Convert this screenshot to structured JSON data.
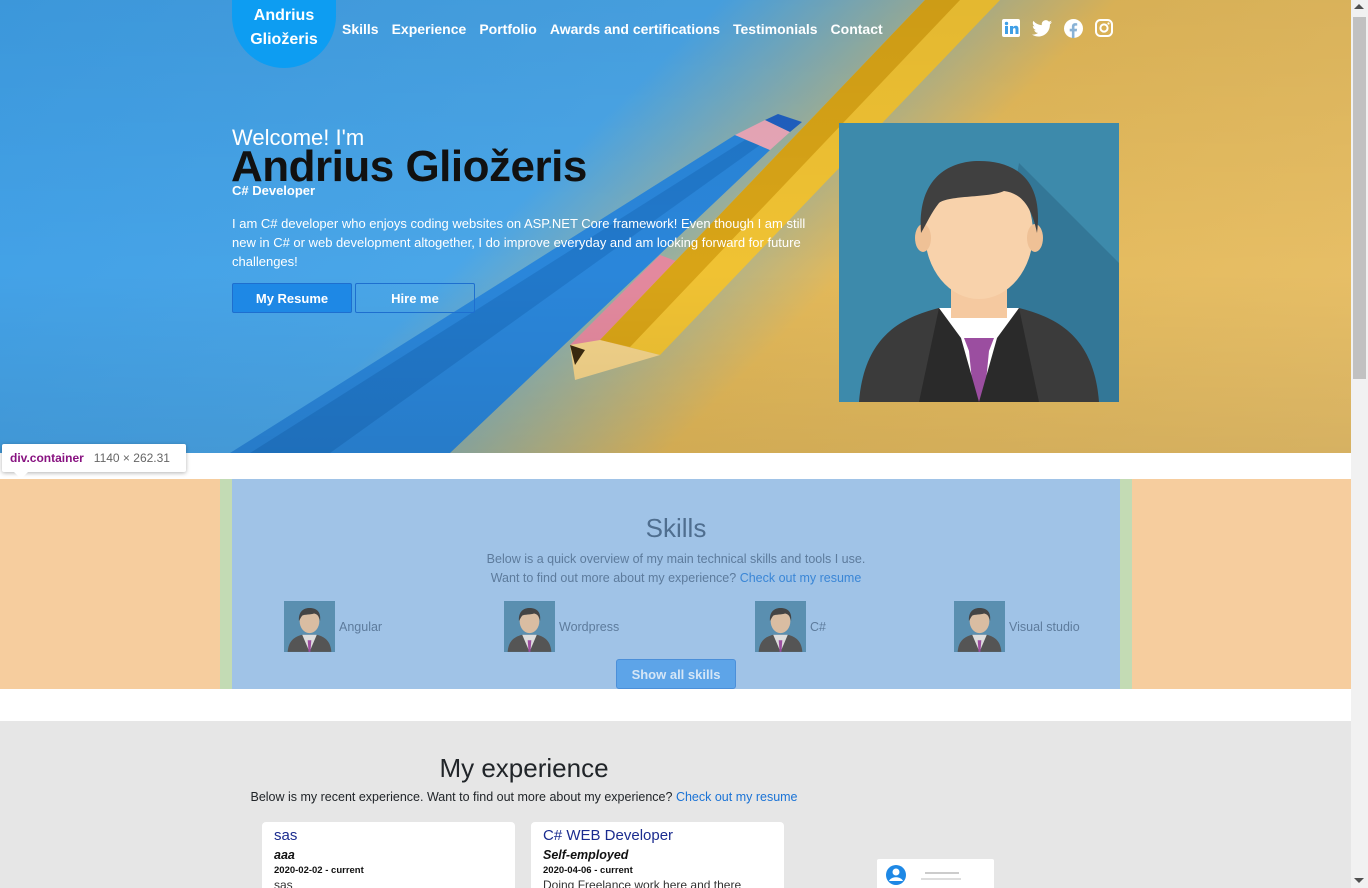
{
  "brand": {
    "line1": "Andrius",
    "line2": "Gliožeris"
  },
  "nav": [
    "Skills",
    "Experience",
    "Portfolio",
    "Awards and certifications",
    "Testimonials",
    "Contact"
  ],
  "social": [
    "linkedin-icon",
    "twitter-icon",
    "facebook-icon",
    "instagram-icon"
  ],
  "hero": {
    "welcome": "Welcome! I'm",
    "name": "Andrius Gliožeris",
    "role": "C# Developer",
    "intro": "I am C# developer who enjoys coding websites on ASP.NET Core framework! Even though I am still new in C# or web development altogether, I do improve everyday and am looking forward for future challenges!",
    "resume_btn": "My Resume",
    "hire_btn": "Hire me"
  },
  "devtools": {
    "tag": "div.container",
    "dims": "1140 × 262.31"
  },
  "skills": {
    "title": "Skills",
    "sub1": "Below is a quick overview of my main technical skills and tools I use.",
    "sub2": "Want to find out more about my experience?",
    "link": "Check out my resume",
    "items": [
      "Angular",
      "Wordpress",
      "C#",
      "Visual studio"
    ],
    "show_all": "Show all skills"
  },
  "experience": {
    "title": "My experience",
    "sub": "Below is my recent experience. Want to find out more about my experience?",
    "link": "Check out my resume",
    "cards": [
      {
        "title": "sas",
        "company": "aaa",
        "date": "2020-02-02 - current",
        "desc": "sas"
      },
      {
        "title": "C# WEB Developer",
        "company": "Self-employed",
        "date": "2020-04-06 - current",
        "desc": "Doing Freelance work here and there"
      }
    ]
  },
  "colors": {
    "accent": "#0d9df2",
    "link": "#1a73d6"
  }
}
